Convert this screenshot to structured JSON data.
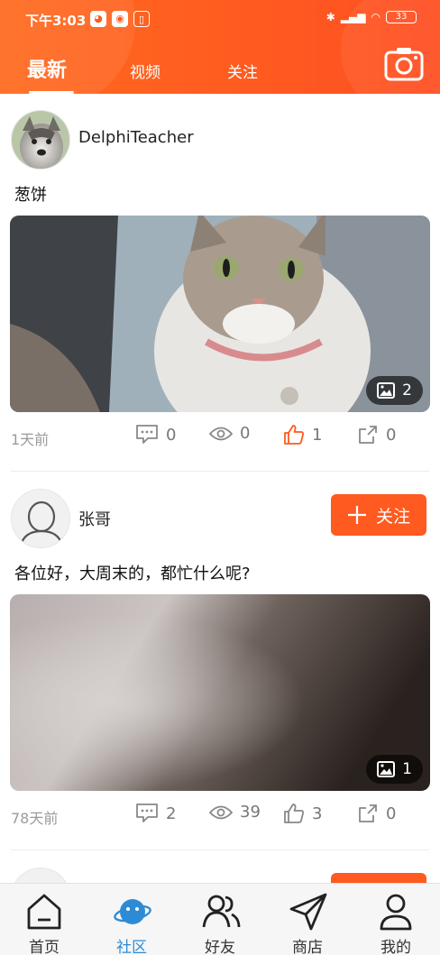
{
  "statusbar": {
    "time": "下午3:03",
    "battery": "33",
    "app_icons": [
      "qq-icon",
      "wechat-icon",
      "tag-icon"
    ],
    "indicators": [
      "bluetooth-icon",
      "signal-icon",
      "wifi-icon"
    ]
  },
  "header": {
    "tabs": [
      {
        "label": "最新",
        "active": true
      },
      {
        "label": "视频",
        "active": false
      },
      {
        "label": "关注",
        "active": false
      }
    ],
    "camera_icon": "camera-icon"
  },
  "posts": [
    {
      "username": "DelphiTeacher",
      "avatar": "husky-photo",
      "text": "葱饼",
      "image_count": "2",
      "time": "1天前",
      "comments": "0",
      "views": "0",
      "likes": "1",
      "liked": true,
      "shares": "0"
    },
    {
      "username": "张哥",
      "avatar": "default-avatar",
      "follow_label": "关注",
      "text": "各位好，大周末的，都忙什么呢?",
      "image_count": "1",
      "time": "78天前",
      "comments": "2",
      "views": "39",
      "likes": "3",
      "liked": false,
      "shares": "0"
    }
  ],
  "bottom_nav": [
    {
      "label": "首页",
      "icon": "home-icon",
      "active": false
    },
    {
      "label": "社区",
      "icon": "planet-icon",
      "active": true
    },
    {
      "label": "好友",
      "icon": "friends-icon",
      "active": false
    },
    {
      "label": "商店",
      "icon": "send-icon",
      "active": false
    },
    {
      "label": "我的",
      "icon": "profile-icon",
      "active": false
    }
  ],
  "colors": {
    "accent": "#ff5a1f",
    "like_active": "#ff5a1f",
    "nav_active": "#2d8bd6"
  }
}
